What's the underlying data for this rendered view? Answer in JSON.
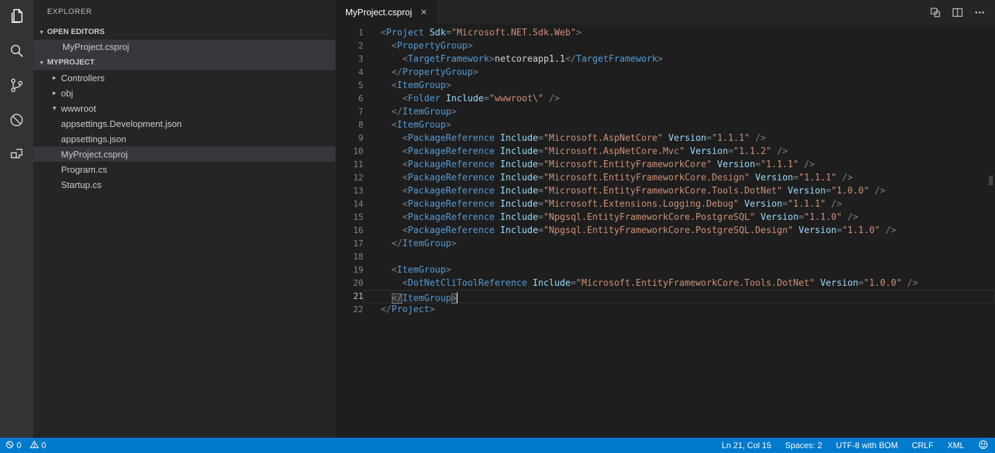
{
  "colors": {
    "statusbar": "#007acc",
    "activitybar_bg": "#333333",
    "sidebar_bg": "#252526",
    "editor_bg": "#1e1e1e",
    "selection_bg": "#37373d",
    "tag": "#569cd6",
    "attribute": "#9cdcfe",
    "string": "#ce9178",
    "punctuation": "#808080",
    "text": "#d4d4d4"
  },
  "activity_bar": {
    "items": [
      {
        "name": "explorer",
        "active": true
      },
      {
        "name": "search",
        "active": false
      },
      {
        "name": "source-control",
        "active": false
      },
      {
        "name": "debug",
        "active": false
      },
      {
        "name": "extensions",
        "active": false
      }
    ]
  },
  "sidebar": {
    "title": "EXPLORER",
    "open_editors": {
      "header": "OPEN EDITORS",
      "items": [
        {
          "label": "MyProject.csproj",
          "selected": true
        }
      ]
    },
    "project": {
      "header": "MYPROJECT"
    },
    "tree": [
      {
        "label": "Controllers",
        "type": "folder",
        "state": "collapsed",
        "selected": false
      },
      {
        "label": "obj",
        "type": "folder",
        "state": "collapsed",
        "selected": false
      },
      {
        "label": "wwwroot",
        "type": "folder",
        "state": "expanded",
        "selected": false
      },
      {
        "label": "appsettings.Development.json",
        "type": "file",
        "selected": false
      },
      {
        "label": "appsettings.json",
        "type": "file",
        "selected": false
      },
      {
        "label": "MyProject.csproj",
        "type": "file",
        "selected": true
      },
      {
        "label": "Program.cs",
        "type": "file",
        "selected": false
      },
      {
        "label": "Startup.cs",
        "type": "file",
        "selected": false
      }
    ]
  },
  "editor": {
    "tab": {
      "label": "MyProject.csproj",
      "close": "×"
    },
    "cursor_line": 21,
    "lines": [
      [
        [
          "pu",
          "<"
        ],
        [
          "tg",
          "Project"
        ],
        [
          "pl",
          " "
        ],
        [
          "at",
          "Sdk"
        ],
        [
          "pu",
          "="
        ],
        [
          "st",
          "\"Microsoft.NET.Sdk.Web\""
        ],
        [
          "pu",
          ">"
        ]
      ],
      [
        [
          "pl",
          "  "
        ],
        [
          "pu",
          "<"
        ],
        [
          "tg",
          "PropertyGroup"
        ],
        [
          "pu",
          ">"
        ]
      ],
      [
        [
          "pl",
          "    "
        ],
        [
          "pu",
          "<"
        ],
        [
          "tg",
          "TargetFramework"
        ],
        [
          "pu",
          ">"
        ],
        [
          "pl",
          "netcoreapp1.1"
        ],
        [
          "pu",
          "</"
        ],
        [
          "tg",
          "TargetFramework"
        ],
        [
          "pu",
          ">"
        ]
      ],
      [
        [
          "pl",
          "  "
        ],
        [
          "pu",
          "</"
        ],
        [
          "tg",
          "PropertyGroup"
        ],
        [
          "pu",
          ">"
        ]
      ],
      [
        [
          "pl",
          "  "
        ],
        [
          "pu",
          "<"
        ],
        [
          "tg",
          "ItemGroup"
        ],
        [
          "pu",
          ">"
        ]
      ],
      [
        [
          "pl",
          "    "
        ],
        [
          "pu",
          "<"
        ],
        [
          "tg",
          "Folder"
        ],
        [
          "pl",
          " "
        ],
        [
          "at",
          "Include"
        ],
        [
          "pu",
          "="
        ],
        [
          "st",
          "\"wwwroot\\\""
        ],
        [
          "pl",
          " "
        ],
        [
          "pu",
          "/>"
        ]
      ],
      [
        [
          "pl",
          "  "
        ],
        [
          "pu",
          "</"
        ],
        [
          "tg",
          "ItemGroup"
        ],
        [
          "pu",
          ">"
        ]
      ],
      [
        [
          "pl",
          "  "
        ],
        [
          "pu",
          "<"
        ],
        [
          "tg",
          "ItemGroup"
        ],
        [
          "pu",
          ">"
        ]
      ],
      [
        [
          "pl",
          "    "
        ],
        [
          "pu",
          "<"
        ],
        [
          "tg",
          "PackageReference"
        ],
        [
          "pl",
          " "
        ],
        [
          "at",
          "Include"
        ],
        [
          "pu",
          "="
        ],
        [
          "st",
          "\"Microsoft.AspNetCore\""
        ],
        [
          "pl",
          " "
        ],
        [
          "at",
          "Version"
        ],
        [
          "pu",
          "="
        ],
        [
          "st",
          "\"1.1.1\""
        ],
        [
          "pl",
          " "
        ],
        [
          "pu",
          "/>"
        ]
      ],
      [
        [
          "pl",
          "    "
        ],
        [
          "pu",
          "<"
        ],
        [
          "tg",
          "PackageReference"
        ],
        [
          "pl",
          " "
        ],
        [
          "at",
          "Include"
        ],
        [
          "pu",
          "="
        ],
        [
          "st",
          "\"Microsoft.AspNetCore.Mvc\""
        ],
        [
          "pl",
          " "
        ],
        [
          "at",
          "Version"
        ],
        [
          "pu",
          "="
        ],
        [
          "st",
          "\"1.1.2\""
        ],
        [
          "pl",
          " "
        ],
        [
          "pu",
          "/>"
        ]
      ],
      [
        [
          "pl",
          "    "
        ],
        [
          "pu",
          "<"
        ],
        [
          "tg",
          "PackageReference"
        ],
        [
          "pl",
          " "
        ],
        [
          "at",
          "Include"
        ],
        [
          "pu",
          "="
        ],
        [
          "st",
          "\"Microsoft.EntityFrameworkCore\""
        ],
        [
          "pl",
          " "
        ],
        [
          "at",
          "Version"
        ],
        [
          "pu",
          "="
        ],
        [
          "st",
          "\"1.1.1\""
        ],
        [
          "pl",
          " "
        ],
        [
          "pu",
          "/>"
        ]
      ],
      [
        [
          "pl",
          "    "
        ],
        [
          "pu",
          "<"
        ],
        [
          "tg",
          "PackageReference"
        ],
        [
          "pl",
          " "
        ],
        [
          "at",
          "Include"
        ],
        [
          "pu",
          "="
        ],
        [
          "st",
          "\"Microsoft.EntityFrameworkCore.Design\""
        ],
        [
          "pl",
          " "
        ],
        [
          "at",
          "Version"
        ],
        [
          "pu",
          "="
        ],
        [
          "st",
          "\"1.1.1\""
        ],
        [
          "pl",
          " "
        ],
        [
          "pu",
          "/>"
        ]
      ],
      [
        [
          "pl",
          "    "
        ],
        [
          "pu",
          "<"
        ],
        [
          "tg",
          "PackageReference"
        ],
        [
          "pl",
          " "
        ],
        [
          "at",
          "Include"
        ],
        [
          "pu",
          "="
        ],
        [
          "st",
          "\"Microsoft.EntityFrameworkCore.Tools.DotNet\""
        ],
        [
          "pl",
          " "
        ],
        [
          "at",
          "Version"
        ],
        [
          "pu",
          "="
        ],
        [
          "st",
          "\"1.0.0\""
        ],
        [
          "pl",
          " "
        ],
        [
          "pu",
          "/>"
        ]
      ],
      [
        [
          "pl",
          "    "
        ],
        [
          "pu",
          "<"
        ],
        [
          "tg",
          "PackageReference"
        ],
        [
          "pl",
          " "
        ],
        [
          "at",
          "Include"
        ],
        [
          "pu",
          "="
        ],
        [
          "st",
          "\"Microsoft.Extensions.Logging.Debug\""
        ],
        [
          "pl",
          " "
        ],
        [
          "at",
          "Version"
        ],
        [
          "pu",
          "="
        ],
        [
          "st",
          "\"1.1.1\""
        ],
        [
          "pl",
          " "
        ],
        [
          "pu",
          "/>"
        ]
      ],
      [
        [
          "pl",
          "    "
        ],
        [
          "pu",
          "<"
        ],
        [
          "tg",
          "PackageReference"
        ],
        [
          "pl",
          " "
        ],
        [
          "at",
          "Include"
        ],
        [
          "pu",
          "="
        ],
        [
          "st",
          "\"Npgsql.EntityFrameworkCore.PostgreSQL\""
        ],
        [
          "pl",
          " "
        ],
        [
          "at",
          "Version"
        ],
        [
          "pu",
          "="
        ],
        [
          "st",
          "\"1.1.0\""
        ],
        [
          "pl",
          " "
        ],
        [
          "pu",
          "/>"
        ]
      ],
      [
        [
          "pl",
          "    "
        ],
        [
          "pu",
          "<"
        ],
        [
          "tg",
          "PackageReference"
        ],
        [
          "pl",
          " "
        ],
        [
          "at",
          "Include"
        ],
        [
          "pu",
          "="
        ],
        [
          "st",
          "\"Npgsql.EntityFrameworkCore.PostgreSQL.Design\""
        ],
        [
          "pl",
          " "
        ],
        [
          "at",
          "Version"
        ],
        [
          "pu",
          "="
        ],
        [
          "st",
          "\"1.1.0\""
        ],
        [
          "pl",
          " "
        ],
        [
          "pu",
          "/>"
        ]
      ],
      [
        [
          "pl",
          "  "
        ],
        [
          "pu",
          "</"
        ],
        [
          "tg",
          "ItemGroup"
        ],
        [
          "pu",
          ">"
        ]
      ],
      [],
      [
        [
          "pl",
          "  "
        ],
        [
          "pu",
          "<"
        ],
        [
          "tg",
          "ItemGroup"
        ],
        [
          "pu",
          ">"
        ]
      ],
      [
        [
          "pl",
          "    "
        ],
        [
          "pu",
          "<"
        ],
        [
          "tg",
          "DotNetCliToolReference"
        ],
        [
          "pl",
          " "
        ],
        [
          "at",
          "Include"
        ],
        [
          "pu",
          "="
        ],
        [
          "st",
          "\"Microsoft.EntityFrameworkCore.Tools.DotNet\""
        ],
        [
          "pl",
          " "
        ],
        [
          "at",
          "Version"
        ],
        [
          "pu",
          "="
        ],
        [
          "st",
          "\"1.0.0\""
        ],
        [
          "pl",
          " "
        ],
        [
          "pu",
          "/>"
        ]
      ],
      [
        [
          "pl",
          "  "
        ],
        [
          "pu",
          "</",
          "bm"
        ],
        [
          "tg",
          "ItemGroup"
        ],
        [
          "pu",
          ">",
          "bm"
        ]
      ],
      [
        [
          "pu",
          "</"
        ],
        [
          "tg",
          "Project"
        ],
        [
          "pu",
          ">"
        ]
      ]
    ]
  },
  "status_bar": {
    "errors": "0",
    "warnings": "0",
    "line_col": "Ln 21, Col 15",
    "indent": "Spaces: 2",
    "encoding": "UTF-8 with BOM",
    "eol": "CRLF",
    "language": "XML"
  }
}
